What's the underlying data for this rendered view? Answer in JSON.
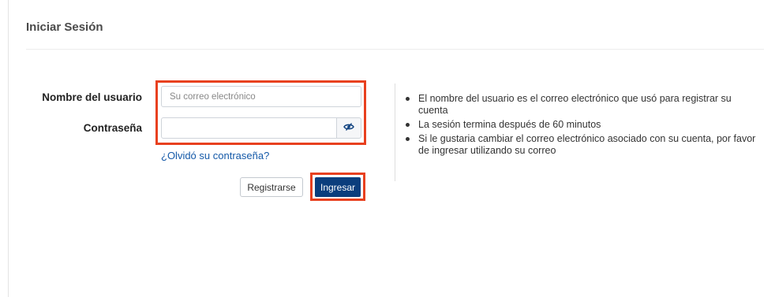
{
  "header": {
    "title": "Iniciar Sesión"
  },
  "form": {
    "username_label": "Nombre del usuario",
    "username_placeholder": "Su correo electrónico",
    "username_value": "",
    "password_label": "Contraseña",
    "password_value": "",
    "password_toggle_icon": "eye-slash-icon",
    "forgot_link": "¿Olvidó su contraseña?",
    "register_button": "Registrarse",
    "submit_button": "Ingresar"
  },
  "info": {
    "items": [
      "El nombre del usuario es el correo electrónico que usó para registrar su cuenta",
      "La sesión termina después de 60 minutos",
      "Si le gustaria cambiar el correo electrónico asociado con su cuenta, por favor de ingresar utilizando su correo"
    ]
  },
  "colors": {
    "primary_button": "#0b3e7d",
    "link": "#1459a8",
    "highlight_border": "#e8401f"
  }
}
